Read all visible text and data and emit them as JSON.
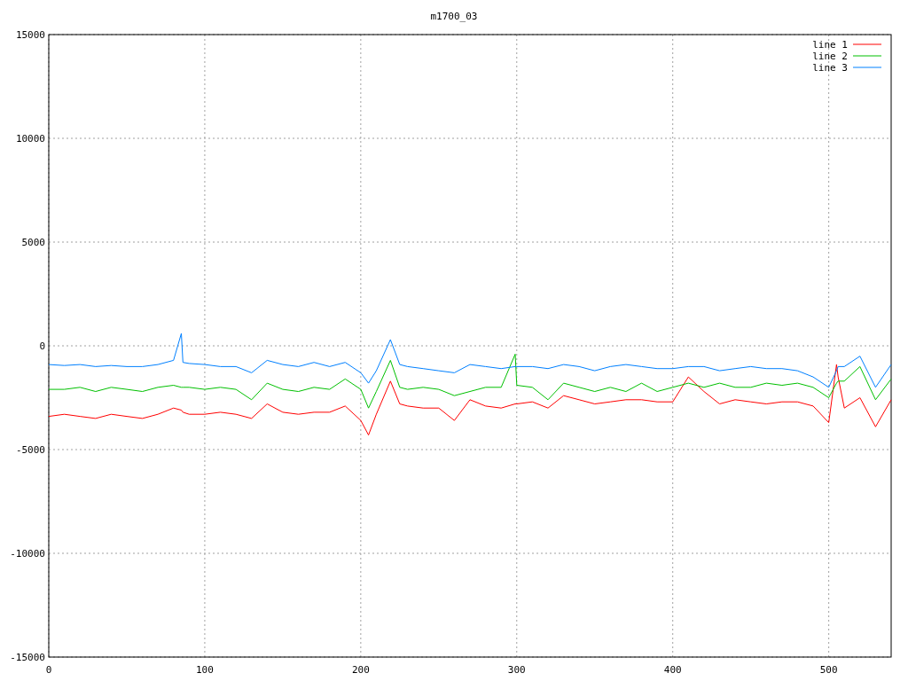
{
  "plot": {
    "chart_data": {
      "type": "line",
      "title": "m1700_03",
      "x": [
        0,
        10,
        20,
        30,
        40,
        50,
        60,
        70,
        80,
        85,
        86,
        90,
        100,
        110,
        120,
        130,
        140,
        150,
        160,
        170,
        180,
        190,
        200,
        205,
        210,
        219,
        225,
        230,
        240,
        250,
        260,
        270,
        280,
        290,
        299,
        300,
        310,
        320,
        330,
        340,
        350,
        360,
        370,
        380,
        390,
        400,
        410,
        420,
        430,
        440,
        450,
        460,
        470,
        480,
        490,
        500,
        505,
        506,
        510,
        520,
        530,
        540
      ],
      "series": [
        {
          "name": "line 1",
          "color": "#ff0000",
          "values": [
            -3400,
            -3300,
            -3400,
            -3500,
            -3300,
            -3400,
            -3500,
            -3300,
            -3000,
            -3100,
            -3200,
            -3300,
            -3300,
            -3200,
            -3300,
            -3500,
            -2800,
            -3200,
            -3300,
            -3200,
            -3200,
            -2900,
            -3600,
            -4300,
            -3300,
            -1700,
            -2800,
            -2900,
            -3000,
            -3000,
            -3600,
            -2600,
            -2900,
            -3000,
            -2800,
            -2800,
            -2700,
            -3000,
            -2400,
            -2600,
            -2800,
            -2700,
            -2600,
            -2600,
            -2700,
            -2700,
            -1500,
            -2200,
            -2800,
            -2600,
            -2700,
            -2800,
            -2700,
            -2700,
            -2900,
            -3700,
            -900,
            -1500,
            -3000,
            -2500,
            -3900,
            -2600
          ]
        },
        {
          "name": "line 2",
          "color": "#00c000",
          "values": [
            -2100,
            -2100,
            -2000,
            -2200,
            -2000,
            -2100,
            -2200,
            -2000,
            -1900,
            -2000,
            -2000,
            -2000,
            -2100,
            -2000,
            -2100,
            -2600,
            -1800,
            -2100,
            -2200,
            -2000,
            -2100,
            -1600,
            -2100,
            -3000,
            -2200,
            -700,
            -2000,
            -2100,
            -2000,
            -2100,
            -2400,
            -2200,
            -2000,
            -2000,
            -400,
            -1900,
            -2000,
            -2600,
            -1800,
            -2000,
            -2200,
            -2000,
            -2200,
            -1800,
            -2200,
            -2000,
            -1800,
            -2000,
            -1800,
            -2000,
            -2000,
            -1800,
            -1900,
            -1800,
            -2000,
            -2500,
            -1800,
            -1700,
            -1700,
            -1000,
            -2600,
            -1600
          ]
        },
        {
          "name": "line 3",
          "color": "#0080ff",
          "values": [
            -900,
            -950,
            -900,
            -1000,
            -950,
            -1000,
            -1000,
            -900,
            -700,
            600,
            -800,
            -850,
            -900,
            -1000,
            -1000,
            -1300,
            -700,
            -900,
            -1000,
            -800,
            -1000,
            -800,
            -1300,
            -1800,
            -1200,
            300,
            -900,
            -1000,
            -1100,
            -1200,
            -1300,
            -900,
            -1000,
            -1100,
            -1000,
            -1000,
            -1000,
            -1100,
            -900,
            -1000,
            -1200,
            -1000,
            -900,
            -1000,
            -1100,
            -1100,
            -1000,
            -1000,
            -1200,
            -1100,
            -1000,
            -1100,
            -1100,
            -1200,
            -1500,
            -2000,
            -1200,
            -1000,
            -1000,
            -500,
            -2000,
            -900
          ]
        }
      ],
      "xlim": [
        0,
        540
      ],
      "ylim": [
        -15000,
        15000
      ],
      "xticks": [
        0,
        100,
        200,
        300,
        400,
        500
      ],
      "yticks": [
        -15000,
        -10000,
        -5000,
        0,
        5000,
        10000,
        15000
      ],
      "grid": true,
      "legend": true
    }
  }
}
